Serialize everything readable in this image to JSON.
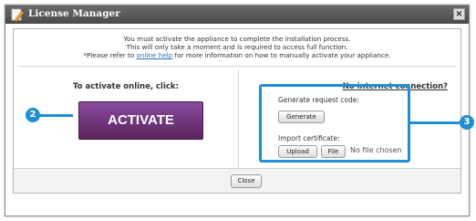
{
  "window": {
    "title": "License Manager",
    "close_glyph": "×"
  },
  "intro": {
    "line1": "You must activate the appliance to complete the installation process.",
    "line2": "This will only take a moment and is required to access full function.",
    "line3_prefix": "*Please refer to ",
    "line3_link": "online help",
    "line3_suffix": " for more information on how to manually activate your appliance."
  },
  "online": {
    "heading": "To activate online, click:",
    "activate_label": "ACTIVATE"
  },
  "offline": {
    "heading": "No internet connection?",
    "request_label": "Generate request code:",
    "generate_label": "Generate",
    "import_label": "Import certificate:",
    "upload_label": "Upload",
    "file_label": "File",
    "file_status": "No file chosen"
  },
  "footer": {
    "close_label": "Close"
  },
  "callouts": {
    "activate_number": "2",
    "offline_number": "3"
  },
  "colors": {
    "callout": "#1e8fd6",
    "activate_button": "#6f3580",
    "titlebar": "#575757",
    "link": "#2a6db5"
  }
}
